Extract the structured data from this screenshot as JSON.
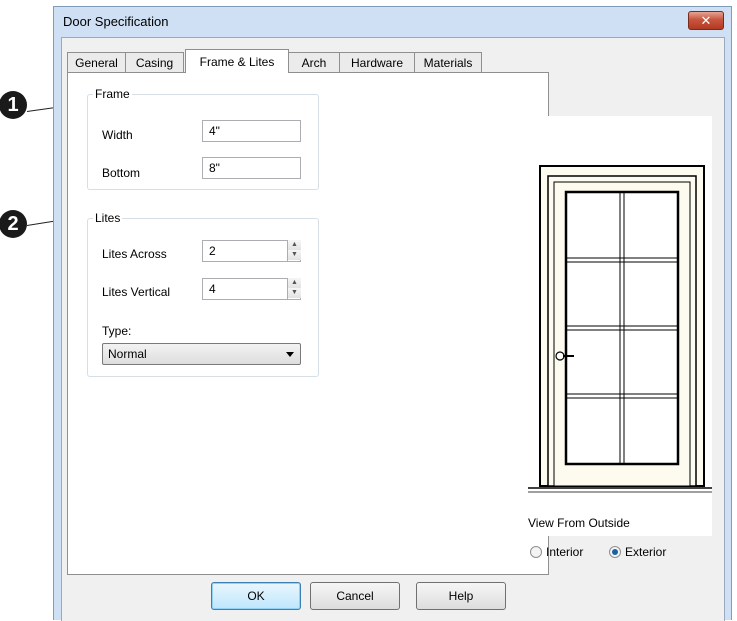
{
  "callouts": [
    "1",
    "2"
  ],
  "window": {
    "title": "Door Specification",
    "close_glyph": "✕"
  },
  "tabs": [
    "General",
    "Casing",
    "Frame & Lites",
    "Arch",
    "Hardware",
    "Materials"
  ],
  "active_tab": "Frame & Lites",
  "frame": {
    "label": "Frame",
    "width_label": "Width",
    "width_value": "4\"",
    "bottom_label": "Bottom",
    "bottom_value": "8\""
  },
  "lites": {
    "label": "Lites",
    "across_label": "Lites Across",
    "across_value": "2",
    "vertical_label": "Lites Vertical",
    "vertical_value": "4",
    "type_label": "Type:",
    "type_value": "Normal"
  },
  "preview": {
    "view_label": "View From Outside",
    "interior_label": "Interior",
    "exterior_label": "Exterior",
    "selected": "Exterior",
    "lites_across": 2,
    "lites_vertical": 4
  },
  "buttons": {
    "ok": "OK",
    "cancel": "Cancel",
    "help": "Help"
  }
}
